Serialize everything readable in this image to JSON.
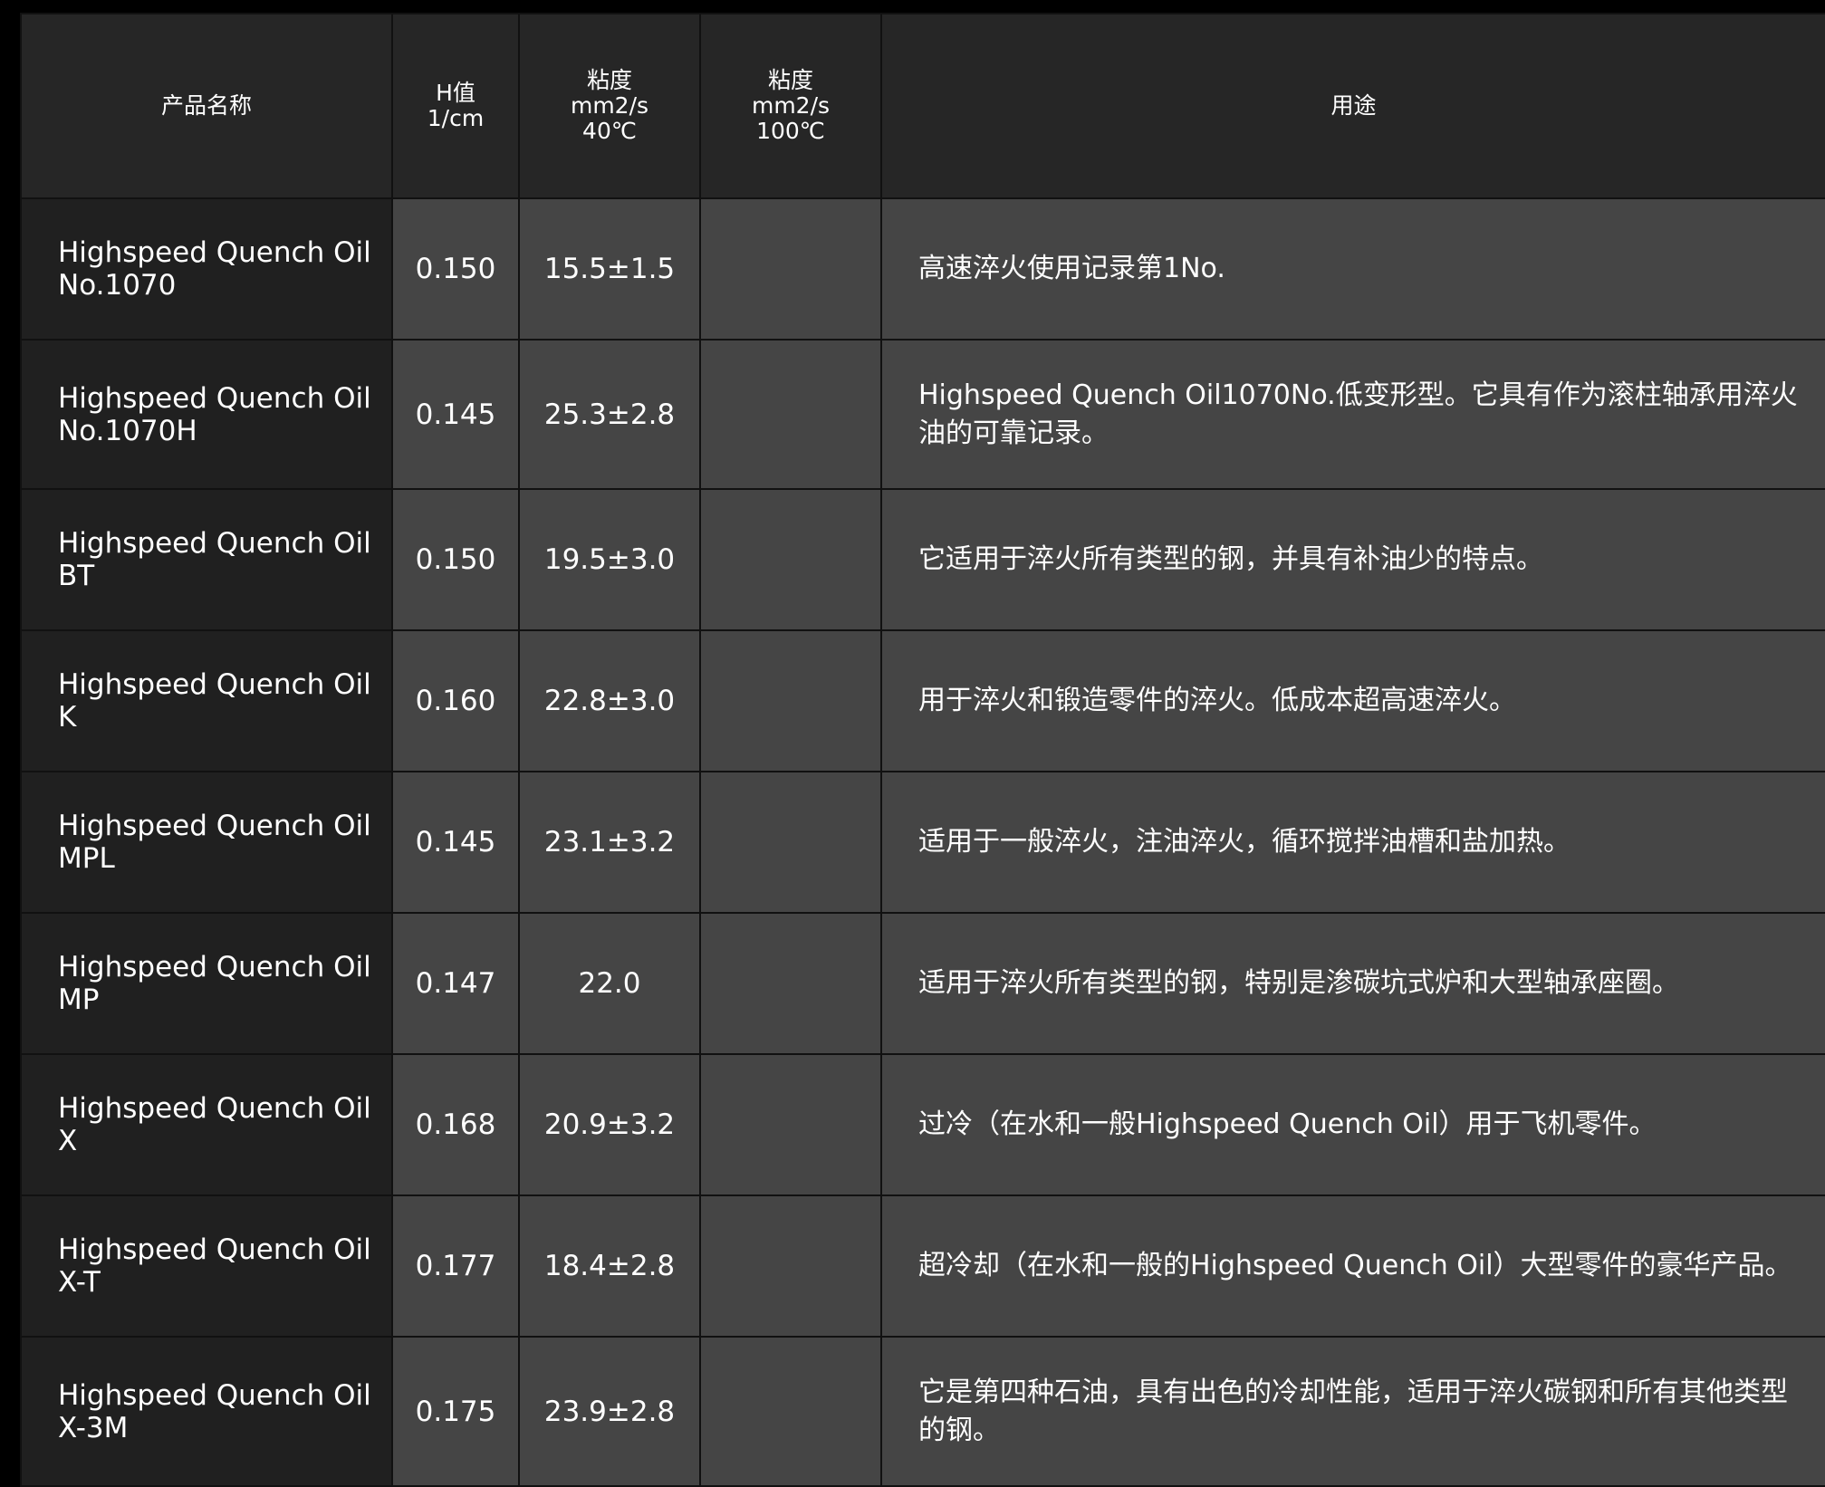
{
  "table": {
    "headers": {
      "name": "产品名称",
      "h_value": [
        "H值",
        "1/cm"
      ],
      "viscosity_40": [
        "粘度",
        "mm2/s",
        "40℃"
      ],
      "viscosity_100": [
        "粘度",
        "mm2/s",
        "100℃"
      ],
      "usage": "用途"
    },
    "rows": [
      {
        "name": [
          "Highspeed Quench Oil",
          "No.1070"
        ],
        "h_value": "0.150",
        "viscosity_40": "15.5±1.5",
        "viscosity_100": "",
        "usage": "高速淬火使用记录第1No."
      },
      {
        "name": [
          "Highspeed Quench Oil",
          "No.1070H"
        ],
        "h_value": "0.145",
        "viscosity_40": "25.3±2.8",
        "viscosity_100": "",
        "usage": "Highspeed Quench Oil1070No.低变形型。它具有作为滚柱轴承用淬火油的可靠记录。"
      },
      {
        "name": [
          "Highspeed Quench Oil",
          "BT"
        ],
        "h_value": "0.150",
        "viscosity_40": "19.5±3.0",
        "viscosity_100": "",
        "usage": "它适用于淬火所有类型的钢，并具有补油少的特点。"
      },
      {
        "name": [
          "Highspeed Quench Oil",
          "K"
        ],
        "h_value": "0.160",
        "viscosity_40": "22.8±3.0",
        "viscosity_100": "",
        "usage": "用于淬火和锻造零件的淬火。低成本超高速淬火。"
      },
      {
        "name": [
          "Highspeed Quench Oil",
          "MPL"
        ],
        "h_value": "0.145",
        "viscosity_40": "23.1±3.2",
        "viscosity_100": "",
        "usage": "适用于一般淬火，注油淬火，循环搅拌油槽和盐加热。"
      },
      {
        "name": [
          "Highspeed Quench Oil",
          "MP"
        ],
        "h_value": "0.147",
        "viscosity_40": "22.0",
        "viscosity_100": "",
        "usage": "适用于淬火所有类型的钢，特别是渗碳坑式炉和大型轴承座圈。"
      },
      {
        "name": [
          "Highspeed Quench Oil",
          "X"
        ],
        "h_value": "0.168",
        "viscosity_40": "20.9±3.2",
        "viscosity_100": "",
        "usage": "过冷（在水和一般Highspeed Quench Oil）用于飞机零件。"
      },
      {
        "name": [
          "Highspeed Quench Oil",
          "X-T"
        ],
        "h_value": "0.177",
        "viscosity_40": "18.4±2.8",
        "viscosity_100": "",
        "usage": "超冷却（在水和一般的Highspeed Quench Oil）大型零件的豪华产品。"
      },
      {
        "name": [
          "Highspeed Quench Oil",
          "X-3M"
        ],
        "h_value": "0.175",
        "viscosity_40": "23.9±2.8",
        "viscosity_100": "",
        "usage": "它是第四种石油，具有出色的冷却性能，适用于淬火碳钢和所有其他类型的钢。"
      }
    ]
  }
}
